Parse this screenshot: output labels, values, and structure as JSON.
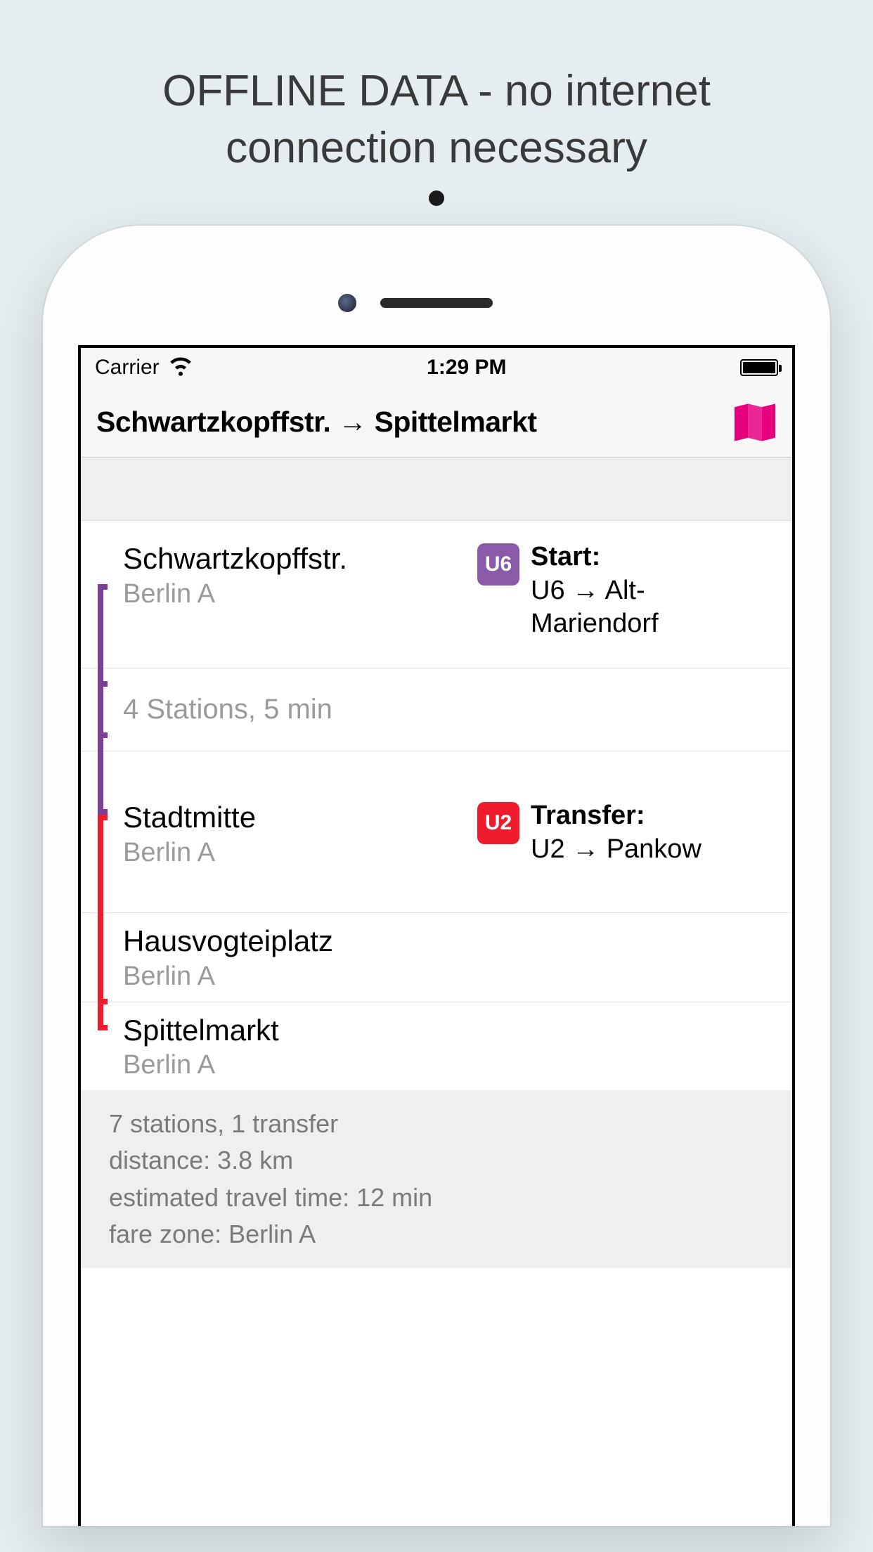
{
  "promo": {
    "line1": "OFFLINE DATA - no internet",
    "line2": "connection necessary"
  },
  "statusBar": {
    "carrier": "Carrier",
    "time": "1:29 PM"
  },
  "navBar": {
    "title": "Schwartzkopffstr. → Spittelmarkt"
  },
  "route": {
    "steps": [
      {
        "station": "Schwartzkopffstr.",
        "zone": "Berlin A",
        "bracketColor": "#7b3f98",
        "badge": {
          "text": "U6",
          "color": "#8a5aa9"
        },
        "actionLabel": "Start:",
        "actionDirection": "U6 → Alt-Mariendorf"
      }
    ],
    "segment1": {
      "text": "4 Stations, 5 min",
      "bracketColor": "#7b3f98"
    },
    "transfer": {
      "station": "Stadtmitte",
      "zone": "Berlin A",
      "bracketTopColor": "#7b3f98",
      "bracketBottomColor": "#ef1c2e",
      "badge": {
        "text": "U2",
        "color": "#ef1c2e"
      },
      "actionLabel": "Transfer:",
      "actionDirection": "U2 → Pankow"
    },
    "stops": [
      {
        "station": "Hausvogteiplatz",
        "zone": "Berlin A",
        "bracketColor": "#ef1c2e"
      },
      {
        "station": "Spittelmarkt",
        "zone": "Berlin A",
        "bracketColor": "#ef1c2e"
      }
    ]
  },
  "summary": {
    "line1": "7 stations, 1 transfer",
    "line2": "distance: 3.8 km",
    "line3": "estimated travel time: 12 min",
    "line4": "fare zone: Berlin A"
  }
}
